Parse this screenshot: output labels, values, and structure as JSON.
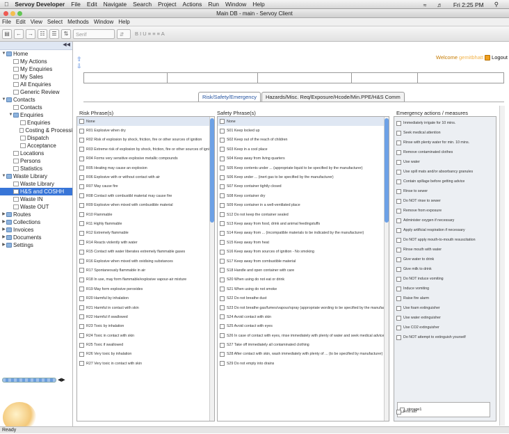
{
  "macbar": {
    "app": "Servoy Developer",
    "menus": [
      "File",
      "Edit",
      "Navigate",
      "Search",
      "Project",
      "Actions",
      "Run",
      "Window",
      "Help"
    ],
    "clock": "Fri 2:25 PM"
  },
  "window": {
    "title": "Main DB - main - Servoy Client"
  },
  "appmenu": [
    "File",
    "Edit",
    "View",
    "Select",
    "Methods",
    "Window",
    "Help"
  ],
  "toolbar": {
    "font": "Serif",
    "fmt": "B  I  U   ≡ ≡ ≡   A"
  },
  "sidebar": {
    "items": [
      {
        "label": "Home",
        "level": 0,
        "type": "folder",
        "open": true
      },
      {
        "label": "My Actions",
        "level": 1,
        "type": "doc"
      },
      {
        "label": "My Enquiries",
        "level": 1,
        "type": "doc"
      },
      {
        "label": "My Sales",
        "level": 1,
        "type": "doc"
      },
      {
        "label": "All Enquiries",
        "level": 1,
        "type": "doc"
      },
      {
        "label": "Generic Review",
        "level": 1,
        "type": "doc"
      },
      {
        "label": "Contacts",
        "level": 0,
        "type": "folder",
        "open": true
      },
      {
        "label": "Contacts",
        "level": 1,
        "type": "doc"
      },
      {
        "label": "Enquiries",
        "level": 1,
        "type": "folder",
        "open": true
      },
      {
        "label": "Enquiries",
        "level": 2,
        "type": "doc"
      },
      {
        "label": "Costing & Processi",
        "level": 2,
        "type": "doc"
      },
      {
        "label": "Dispatch",
        "level": 2,
        "type": "doc"
      },
      {
        "label": "Acceptance",
        "level": 2,
        "type": "doc"
      },
      {
        "label": "Locations",
        "level": 1,
        "type": "doc"
      },
      {
        "label": "Persons",
        "level": 1,
        "type": "doc"
      },
      {
        "label": "Statistics",
        "level": 1,
        "type": "doc"
      },
      {
        "label": "Waste Library",
        "level": 0,
        "type": "folder",
        "open": true
      },
      {
        "label": "Waste Library",
        "level": 1,
        "type": "doc"
      },
      {
        "label": "H&S and COSHH",
        "level": 1,
        "type": "doc",
        "selected": true
      },
      {
        "label": "Waste IN",
        "level": 1,
        "type": "doc"
      },
      {
        "label": "Waste OUT",
        "level": 1,
        "type": "doc"
      },
      {
        "label": "Routes",
        "level": 0,
        "type": "folder",
        "open": false
      },
      {
        "label": "Collections",
        "level": 0,
        "type": "folder",
        "open": false
      },
      {
        "label": "Invoices",
        "level": 0,
        "type": "folder",
        "open": false
      },
      {
        "label": "Documents",
        "level": 0,
        "type": "folder",
        "open": false
      },
      {
        "label": "Settings",
        "level": 0,
        "type": "folder",
        "open": false
      }
    ]
  },
  "header": {
    "welcome": "Welcome",
    "username": "gemitbhatt",
    "logout": "Logout"
  },
  "tabs": [
    "Risk/Safety/Emergency",
    "Hazards/Misc. Req/Exposure/Hcode/Min.PPE/H&S Comm"
  ],
  "columns": {
    "risk_title": "Risk Phrase(s)",
    "safety_title": "Safety Phrase(s)",
    "emergency_title": "Emergency actions / measures"
  },
  "risk": [
    "None",
    "R01 Explosive when dry",
    "R02 Risk of explosion by shock, friction, fire or other sources of ignition",
    "R03 Extreme risk of explosion by shock, friction, fire or other sources of ignition",
    "R04 Forms very sensitive explosive metallic compounds",
    "R05 Heating may cause an explosion",
    "R06 Explosive with or without contact with air",
    "R07 May cause fire",
    "R08 Contact with combustibl material may cause fire",
    "R09 Explosive when mixed with combustible material",
    "R10 Flammable",
    "R11 Highly flammable",
    "R12 Extremely flammable",
    "R14 Reacts violently with water",
    "R15 Contact with water liberates extremely flammable gases",
    "R16 Explosive when mixed with oxidising substances",
    "R17 Spontaneously flammable in air",
    "R18 In use, may form flammable/explosive vapour-air mixture",
    "R19 May form explosive peroxides",
    "R20 Harmful by inhalation",
    "R21 Harmful in contact with skin",
    "R22 Harmful if swallowed",
    "R23 Toxic by inhalation",
    "R24 Toxic in contact with skin",
    "R25 Toxic if swallowed",
    "R26 Very toxic by inhalation",
    "R27 Very toxic in contact with skin"
  ],
  "safety": [
    "None",
    "S01 Keep locked up",
    "S02 Keep out of the reach of children",
    "S03 Keep in a cool place",
    "S04 Keep away from living quarters",
    "S05 Keep contents under ... (appropriate liquid to be specified by the manufacturer)",
    "S06 Keep under ... (inert gas to be specified by the manufacturer)",
    "S07 Keep container tightly closed",
    "S08 Keep container dry",
    "S09 Keep container in a well-ventilated place",
    "S12 Do not keep the container sealed",
    "S13 Keep away from food, drink and animal feedingstuffs",
    "S14 Keep away from ... (incompatible materials to be indicated by the manufacturer)",
    "S15 Keep away from heat",
    "S16 Keep away from sources of ignition - No smoking",
    "S17 Keep away from combustible material",
    "S18 Handle and open container with care",
    "S20 When using do not eat or drink",
    "S21 When using do not smoke",
    "S22 Do not breathe dust",
    "S23 Do not breathe gas/fumes/vapour/spray (appropriate wording to be specified by the manufacturer)",
    "S24 Avoid contact with skin",
    "S25 Avoid contact with eyes",
    "S26 In case of contact with eyes, rinse immediately with plenty of water and seek medical advice",
    "S27 Take off immediately all contaminated clothing",
    "S28 After contact with skin, wash immediately with plenty of ... (to be specified by manufacturer)",
    "S29 Do not empty into drains"
  ],
  "emergency": [
    "Immediately irrigate for 10 mins.",
    "Seek medical attention",
    "Rinse with plenty water for min. 10 mins.",
    "Remove contaminated clothes",
    "Use water",
    "Use spill mats and/or absorbancy granules",
    "Contain spillage before getting advice",
    "Rinse to sewer",
    "Do NOT rinse to sewer",
    "Remove from exposure",
    "Administer oxygen if necessary",
    "Apply artificial respiration if necessary",
    "Do NOT apply mouth-to-mouth resuscitation",
    "Rinse mouth with water",
    "Give water to drink",
    "Give milk to drink",
    "Do NOT induce vomiting",
    "Induce vomiting",
    "Raise fire alarm",
    "Use foam extinguisher",
    "Use water extinguisher",
    "Use CO2 extinguisher",
    "Do NOT attempt to extinguish yourself"
  ],
  "storage": "storage1",
  "firstaid": "First aid",
  "status": "Ready",
  "colors": {
    "accent": "#3875d7",
    "welcome": "#c67b00"
  }
}
